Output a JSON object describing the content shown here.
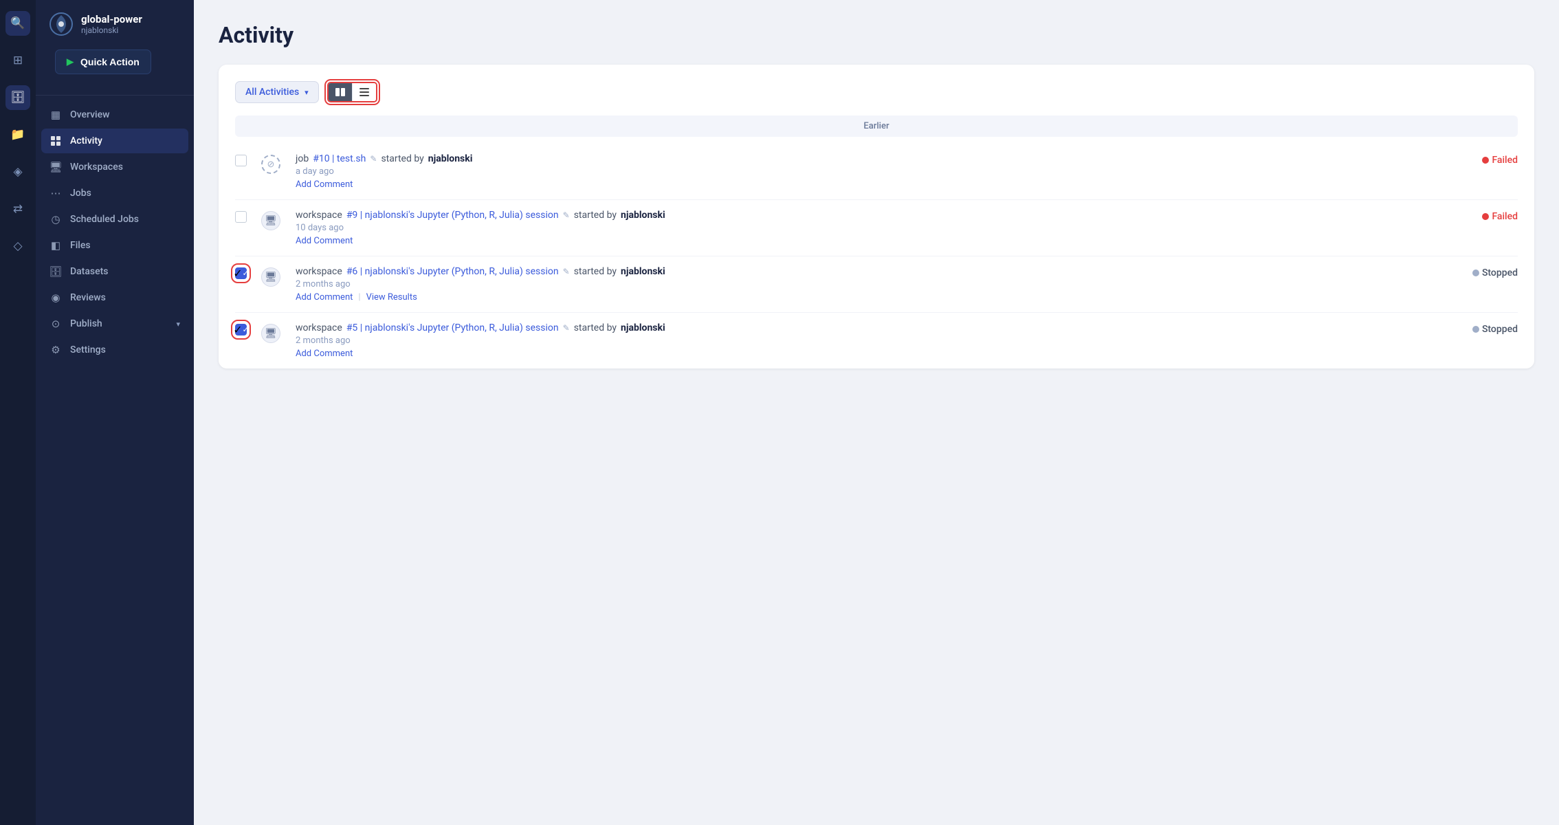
{
  "sidebar": {
    "org_name": "global-power",
    "username": "njablonski",
    "quick_action_label": "Quick Action",
    "nav_items": [
      {
        "id": "overview",
        "label": "Overview",
        "icon": "▦",
        "active": false
      },
      {
        "id": "activity",
        "label": "Activity",
        "icon": "⊞",
        "active": true
      },
      {
        "id": "workspaces",
        "label": "Workspaces",
        "icon": "▣",
        "active": false
      },
      {
        "id": "jobs",
        "label": "Jobs",
        "icon": "⋯",
        "active": false
      },
      {
        "id": "scheduled-jobs",
        "label": "Scheduled Jobs",
        "icon": "◷",
        "active": false
      },
      {
        "id": "files",
        "label": "Files",
        "icon": "◧",
        "active": false
      },
      {
        "id": "datasets",
        "label": "Datasets",
        "icon": "⊕",
        "active": false
      },
      {
        "id": "reviews",
        "label": "Reviews",
        "icon": "◉",
        "active": false
      },
      {
        "id": "publish",
        "label": "Publish",
        "icon": "⊙",
        "active": false
      },
      {
        "id": "settings",
        "label": "Settings",
        "icon": "⚙",
        "active": false
      }
    ],
    "left_icons": [
      {
        "id": "search",
        "icon": "🔍"
      },
      {
        "id": "grid",
        "icon": "⊞"
      },
      {
        "id": "database",
        "icon": "⊕"
      },
      {
        "id": "folder",
        "icon": "📁"
      },
      {
        "id": "cube",
        "icon": "◈"
      },
      {
        "id": "arrows",
        "icon": "⇄"
      },
      {
        "id": "tag",
        "icon": "◇"
      }
    ]
  },
  "page": {
    "title": "Activity"
  },
  "filter": {
    "label": "All Activities",
    "chevron": "▾"
  },
  "section": {
    "earlier_label": "Earlier"
  },
  "activities": [
    {
      "id": 1,
      "checked": false,
      "highlight": false,
      "icon_type": "spinner",
      "type_label": "job",
      "link_text": "#10 | test.sh",
      "edit_icon": "✎",
      "started_label": "started by",
      "user": "njablonski",
      "time": "a day ago",
      "actions": [
        "Add Comment"
      ],
      "status": "Failed",
      "status_type": "failed"
    },
    {
      "id": 2,
      "checked": false,
      "highlight": false,
      "icon_type": "monitor",
      "type_label": "workspace",
      "link_text": "#9 | njablonski's Jupyter (Python, R, Julia) session",
      "edit_icon": "✎",
      "started_label": "started by",
      "user": "njablonski",
      "time": "10 days ago",
      "actions": [
        "Add Comment"
      ],
      "status": "Failed",
      "status_type": "failed"
    },
    {
      "id": 3,
      "checked": true,
      "highlight": true,
      "icon_type": "monitor",
      "type_label": "workspace",
      "link_text": "#6 | njablonski's Jupyter (Python, R, Julia) session",
      "edit_icon": "✎",
      "started_label": "started by",
      "user": "njablonski",
      "time": "2 months ago",
      "actions": [
        "Add Comment",
        "View Results"
      ],
      "status": "Stopped",
      "status_type": "stopped"
    },
    {
      "id": 4,
      "checked": true,
      "highlight": true,
      "icon_type": "monitor",
      "type_label": "workspace",
      "link_text": "#5 | njablonski's Jupyter (Python, R, Julia) session",
      "edit_icon": "✎",
      "started_label": "started by",
      "user": "njablonski",
      "time": "2 months ago",
      "actions": [
        "Add Comment"
      ],
      "status": "Stopped",
      "status_type": "stopped"
    }
  ]
}
